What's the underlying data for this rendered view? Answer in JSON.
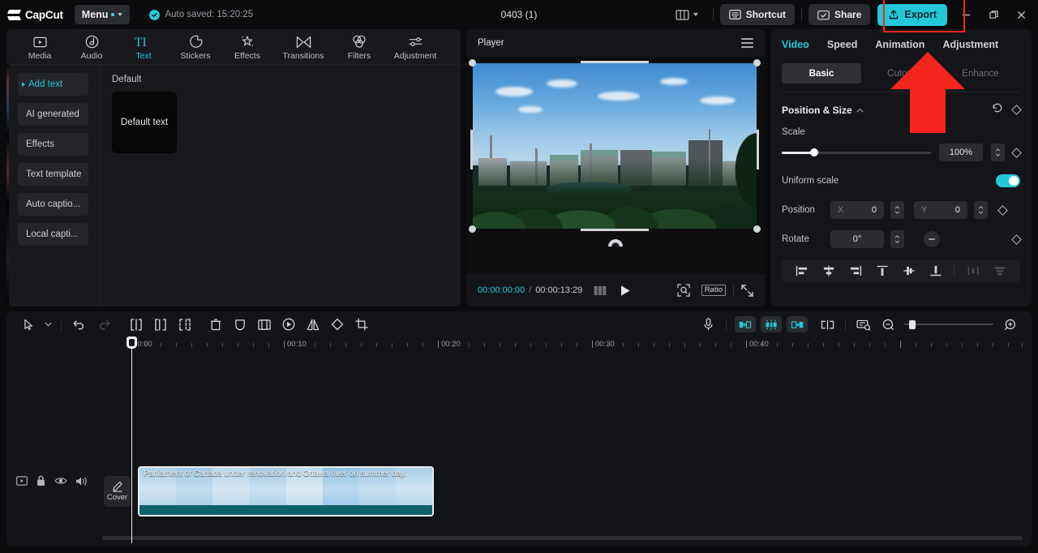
{
  "titlebar": {
    "brand": "CapCut",
    "menu_label": "Menu",
    "autosave_text": "Auto saved: 15:20:25",
    "project_title": "0403 (1)",
    "shortcut_label": "Shortcut",
    "share_label": "Share",
    "export_label": "Export",
    "accent_color": "#22c8d8"
  },
  "categories": [
    {
      "label": "Media",
      "icon": "media-icon",
      "active": false
    },
    {
      "label": "Audio",
      "icon": "audio-icon",
      "active": false
    },
    {
      "label": "Text",
      "icon": "text-icon",
      "active": true
    },
    {
      "label": "Stickers",
      "icon": "stickers-icon",
      "active": false
    },
    {
      "label": "Effects",
      "icon": "effects-icon",
      "active": false
    },
    {
      "label": "Transitions",
      "icon": "transitions-icon",
      "active": false
    },
    {
      "label": "Filters",
      "icon": "filters-icon",
      "active": false
    },
    {
      "label": "Adjustment",
      "icon": "adjustment-icon",
      "active": false
    }
  ],
  "sidebar": {
    "items": [
      {
        "label": "Add text",
        "active": true
      },
      {
        "label": "AI generated",
        "active": false
      },
      {
        "label": "Effects",
        "active": false
      },
      {
        "label": "Text template",
        "active": false
      },
      {
        "label": "Auto captio...",
        "active": false
      },
      {
        "label": "Local capti...",
        "active": false
      }
    ]
  },
  "text_library": {
    "group_title": "Default",
    "default_card_label": "Default text"
  },
  "player": {
    "title": "Player",
    "current_time": "00:00:00:00",
    "time_separator": "/",
    "total_time": "00:00:13:29",
    "ratio_label": "Ratio"
  },
  "right_panel": {
    "tabs": [
      {
        "label": "Video",
        "active": true
      },
      {
        "label": "Speed",
        "active": false
      },
      {
        "label": "Animation",
        "active": false
      },
      {
        "label": "Adjustment",
        "active": false
      }
    ],
    "segments": [
      {
        "label": "Basic",
        "active": true,
        "enabled": true
      },
      {
        "label": "Cutout",
        "active": false,
        "enabled": false
      },
      {
        "label": "Enhance",
        "active": false,
        "enabled": false
      }
    ],
    "section_title": "Position & Size",
    "scale_label": "Scale",
    "scale_value": "100%",
    "scale_percent": 22,
    "uniform_scale_label": "Uniform scale",
    "uniform_scale_on": true,
    "position_label": "Position",
    "position_x_axis": "X",
    "position_x_value": "0",
    "position_y_axis": "Y",
    "position_y_value": "0",
    "rotate_label": "Rotate",
    "rotate_value": "0°",
    "align_buttons": [
      "align-left-icon",
      "align-center-horizontal-icon",
      "align-right-icon",
      "align-top-icon",
      "align-center-vertical-icon",
      "align-bottom-icon",
      "distribute-horizontal-icon",
      "distribute-vertical-icon"
    ]
  },
  "timeline": {
    "tools": [
      "select-tool-icon",
      "select-dropdown-icon",
      "undo-icon",
      "redo-icon",
      "split-icon",
      "trim-start-icon",
      "trim-end-icon",
      "delete-icon",
      "mask-icon",
      "freeze-icon",
      "speed-icon",
      "mirror-icon",
      "rotate-icon",
      "crop-icon"
    ],
    "right_tools": [
      "microphone-icon",
      "snap-left-icon",
      "magnet-icon",
      "snap-right-icon",
      "link-icon",
      "keyframe-icon",
      "zoom-out-icon",
      "zoom-slider",
      "zoom-in-icon"
    ],
    "ruler_labels": [
      "00:00",
      "00:10",
      "00:20",
      "00:30",
      "00:40"
    ],
    "track_controls": [
      "track-thumbnail-icon",
      "lock-icon",
      "eye-icon",
      "speaker-icon"
    ],
    "cover_label": "Cover",
    "clip": {
      "name": "Parliament of Canada under renovation and Ottawa river on summer day.",
      "selected": true
    }
  },
  "annotations": {
    "highlight_color": "#f5241f",
    "rect_target": "export-button",
    "arrow_target": "animation-tab"
  }
}
